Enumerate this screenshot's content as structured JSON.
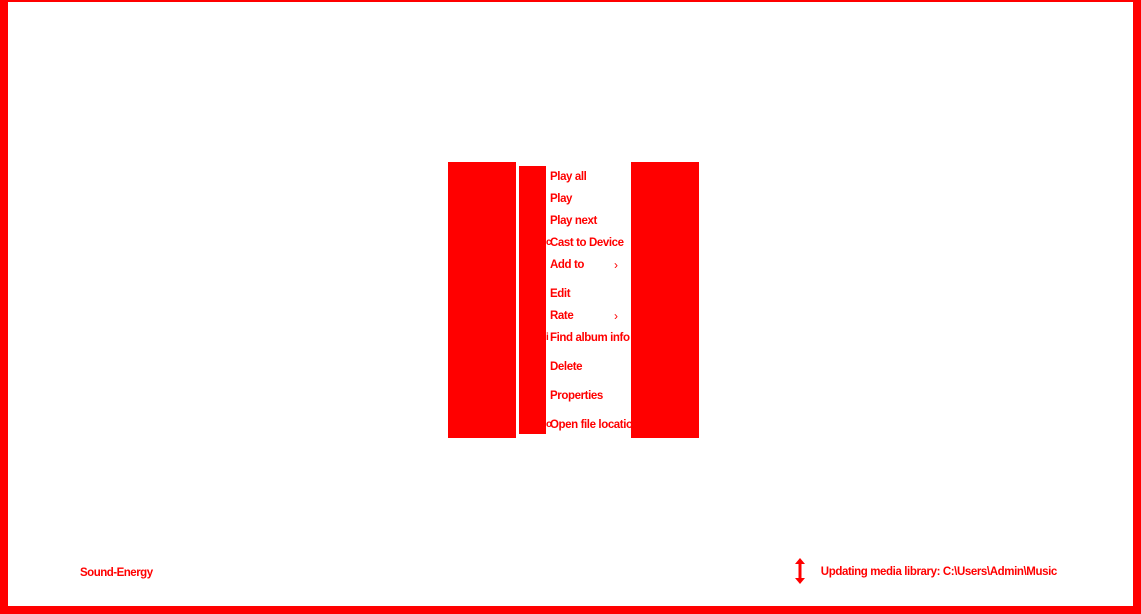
{
  "colors": {
    "accent": "#ff0000",
    "background": "#ffffff"
  },
  "context_menu": {
    "items": [
      {
        "label": "Play all",
        "icon": ""
      },
      {
        "label": "Play",
        "icon": ""
      },
      {
        "label": "Play next",
        "icon": ""
      },
      {
        "label": "Cast to Device",
        "icon": "cast-icon"
      },
      {
        "label": "Add to",
        "icon": "",
        "submenu": "chevron-right-icon"
      },
      {
        "label": "Edit",
        "icon": ""
      },
      {
        "label": "Rate",
        "icon": "",
        "submenu": "chevron-right-icon"
      },
      {
        "label": "Find album info",
        "icon": "album-info-icon"
      },
      {
        "label": "Delete",
        "icon": ""
      },
      {
        "label": "Properties",
        "icon": ""
      },
      {
        "label": "Open file location",
        "icon": "folder-icon"
      }
    ],
    "chevron_glyph": "›"
  },
  "status_bar": {
    "left_text": "Sound-Energy",
    "sync_icon": "sync-icon",
    "right_text": "Updating media library: C:\\Users\\Admin\\Music"
  }
}
